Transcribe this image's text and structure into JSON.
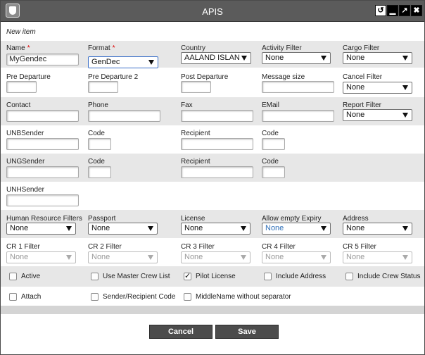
{
  "window": {
    "title": "APIS",
    "subtitle": "New item"
  },
  "titlebar_icons": [
    "shield-icon",
    "restore-icon",
    "minimize-icon",
    "maximize-icon",
    "close-icon"
  ],
  "rows": {
    "r1": {
      "name": {
        "label": "Name",
        "required": "*",
        "value": "MyGendec"
      },
      "format": {
        "label": "Format",
        "required": "*",
        "value": "GenDec"
      },
      "country": {
        "label": "Country",
        "value": "AALAND ISLAN"
      },
      "activity_filter": {
        "label": "Activity Filter",
        "value": "None"
      },
      "cargo_filter": {
        "label": "Cargo Filter",
        "value": "None"
      }
    },
    "r2": {
      "pre_departure": {
        "label": "Pre Departure",
        "value": ""
      },
      "pre_departure_2": {
        "label": "Pre Departure 2",
        "value": ""
      },
      "post_departure": {
        "label": "Post Departure",
        "value": ""
      },
      "message_size": {
        "label": "Message size",
        "value": ""
      },
      "cancel_filter": {
        "label": "Cancel Filter",
        "value": "None"
      }
    },
    "r3": {
      "contact": {
        "label": "Contact",
        "value": ""
      },
      "phone": {
        "label": "Phone",
        "value": ""
      },
      "fax": {
        "label": "Fax",
        "value": ""
      },
      "email": {
        "label": "EMail",
        "value": ""
      },
      "report_filter": {
        "label": "Report Filter",
        "value": "None"
      }
    },
    "r4": {
      "unb_sender": {
        "label": "UNBSender",
        "value": ""
      },
      "code1": {
        "label": "Code",
        "value": ""
      },
      "recipient": {
        "label": "Recipient",
        "value": ""
      },
      "code2": {
        "label": "Code",
        "value": ""
      }
    },
    "r5": {
      "ung_sender": {
        "label": "UNGSender",
        "value": ""
      },
      "code1": {
        "label": "Code",
        "value": ""
      },
      "recipient": {
        "label": "Recipient",
        "value": ""
      },
      "code2": {
        "label": "Code",
        "value": ""
      }
    },
    "r6": {
      "unh_sender": {
        "label": "UNHSender",
        "value": ""
      }
    },
    "r7": {
      "hr_filters": {
        "label": "Human Resource Filters",
        "value": "None"
      },
      "passport": {
        "label": "Passport",
        "value": "None"
      },
      "license": {
        "label": "License",
        "value": "None"
      },
      "allow_empty_expiry": {
        "label": "Allow empty Expiry",
        "value": "None"
      },
      "address": {
        "label": "Address",
        "value": "None"
      }
    },
    "r8": {
      "cr1": {
        "label": "CR 1 Filter",
        "value": "None"
      },
      "cr2": {
        "label": "CR 2 Filter",
        "value": "None"
      },
      "cr3": {
        "label": "CR 3 Filter",
        "value": "None"
      },
      "cr4": {
        "label": "CR 4 Filter",
        "value": "None"
      },
      "cr5": {
        "label": "CR 5 Filter",
        "value": "None"
      }
    }
  },
  "checkboxes": {
    "active": {
      "label": "Active",
      "checked": false
    },
    "use_master_crew_list": {
      "label": "Use Master Crew List",
      "checked": false
    },
    "pilot_license": {
      "label": "Pilot License",
      "checked": true
    },
    "include_address": {
      "label": "Include Address",
      "checked": false
    },
    "include_crew_status": {
      "label": "Include Crew Status",
      "checked": false
    },
    "attach": {
      "label": "Attach",
      "checked": false
    },
    "sender_recipient_code": {
      "label": "Sender/Recipient Code",
      "checked": false
    },
    "middlename_without_separator": {
      "label": "MiddleName without separator",
      "checked": false
    }
  },
  "buttons": {
    "cancel": "Cancel",
    "save": "Save"
  },
  "colors": {
    "titlebar": "#5b5b5b",
    "shaded_row": "#e7e7e7",
    "button": "#4c4c4c",
    "required": "#dd0000",
    "link_value": "#2f6fb8"
  }
}
